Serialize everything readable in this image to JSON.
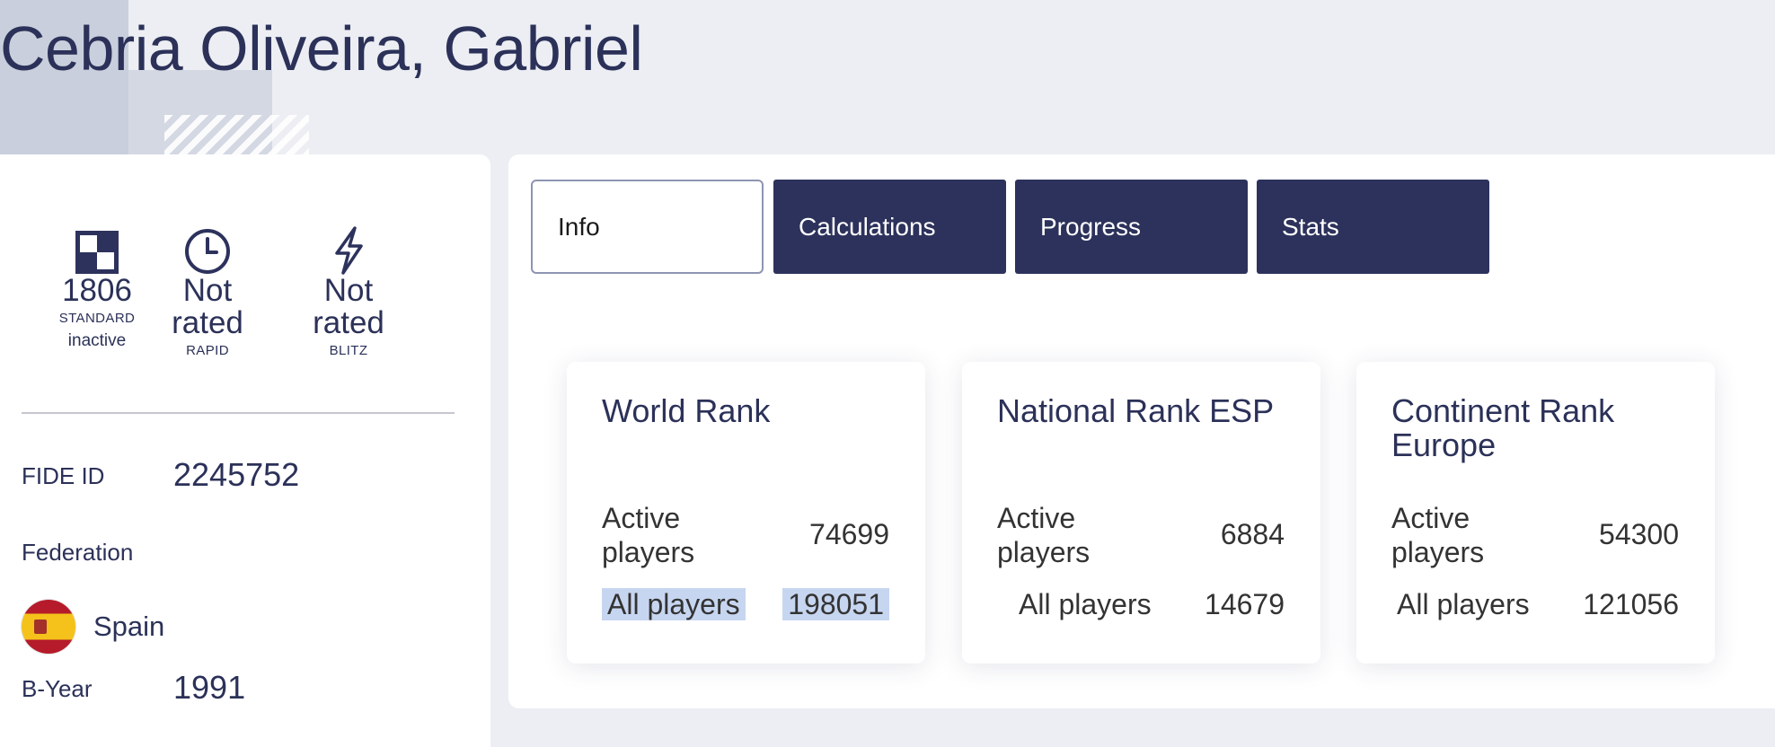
{
  "player": {
    "name": "Cebria Oliveira, Gabriel"
  },
  "ratings": {
    "standard": {
      "value": "1806",
      "label": "STANDARD",
      "status": "inactive",
      "icon": "chessboard-icon"
    },
    "rapid": {
      "value_line1": "Not",
      "value_line2": "rated",
      "label": "RAPID",
      "icon": "clock-icon"
    },
    "blitz": {
      "value_line1": "Not",
      "value_line2": "rated",
      "label": "BLITZ",
      "icon": "lightning-icon"
    }
  },
  "info": {
    "fide_id_label": "FIDE ID",
    "fide_id": "2245752",
    "federation_label": "Federation",
    "federation": "Spain",
    "federation_flag": "spain-flag-icon",
    "byear_label": "B-Year",
    "byear": "1991"
  },
  "tabs": [
    "Info",
    "Calculations",
    "Progress",
    "Stats"
  ],
  "ranks": [
    {
      "title": "World Rank",
      "active_label": "Active players",
      "active": "74699",
      "all_label": "All players",
      "all": "198051"
    },
    {
      "title": "National Rank ESP",
      "active_label": "Active players",
      "active": "6884",
      "all_label": "All players",
      "all": "14679"
    },
    {
      "title": "Continent Rank Europe",
      "active_label": "Active players",
      "active": "54300",
      "all_label": "All players",
      "all": "121056"
    }
  ],
  "colors": {
    "navy": "#2d325c",
    "background": "#eceef3",
    "highlight": "#c7d6f0"
  }
}
